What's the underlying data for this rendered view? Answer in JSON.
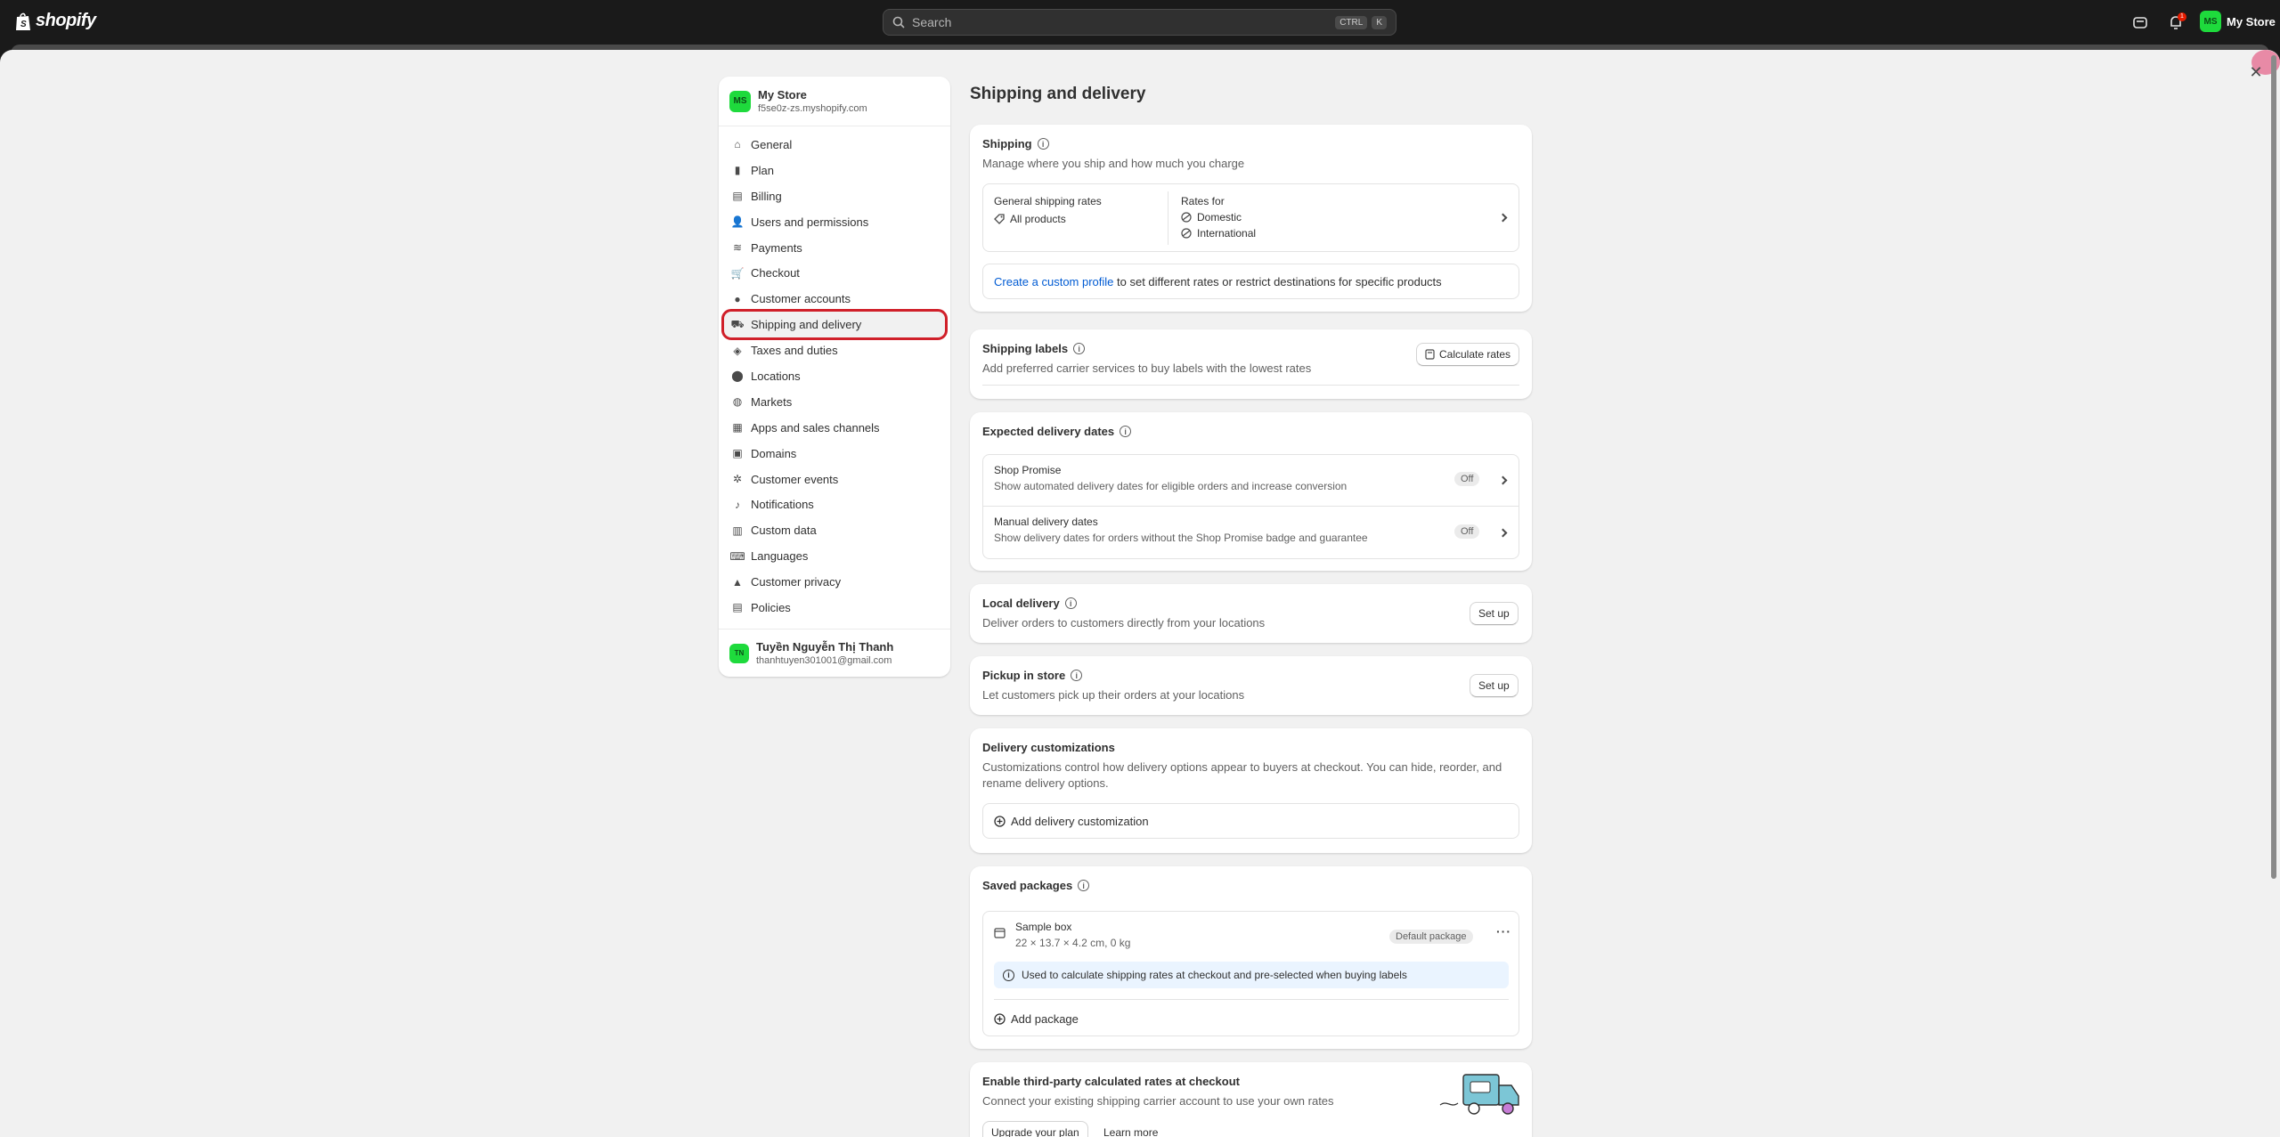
{
  "topbar": {
    "logo": "shopify",
    "search_placeholder": "Search",
    "kbd1": "CTRL",
    "kbd2": "K",
    "notif_count": "1",
    "store_initials": "MS",
    "store_name": "My Store"
  },
  "sidebar": {
    "store_initials": "MS",
    "store_name": "My Store",
    "store_domain": "f5se0z-zs.myshopify.com",
    "items": [
      {
        "label": "General",
        "icon": "store-icon"
      },
      {
        "label": "Plan",
        "icon": "plan-icon"
      },
      {
        "label": "Billing",
        "icon": "billing-icon"
      },
      {
        "label": "Users and permissions",
        "icon": "users-icon"
      },
      {
        "label": "Payments",
        "icon": "payments-icon"
      },
      {
        "label": "Checkout",
        "icon": "cart-icon"
      },
      {
        "label": "Customer accounts",
        "icon": "person-icon"
      },
      {
        "label": "Shipping and delivery",
        "icon": "truck-icon"
      },
      {
        "label": "Taxes and duties",
        "icon": "tax-icon"
      },
      {
        "label": "Locations",
        "icon": "location-icon"
      },
      {
        "label": "Markets",
        "icon": "globe-icon"
      },
      {
        "label": "Apps and sales channels",
        "icon": "apps-icon"
      },
      {
        "label": "Domains",
        "icon": "domain-icon"
      },
      {
        "label": "Customer events",
        "icon": "events-icon"
      },
      {
        "label": "Notifications",
        "icon": "bell-icon"
      },
      {
        "label": "Custom data",
        "icon": "data-icon"
      },
      {
        "label": "Languages",
        "icon": "language-icon"
      },
      {
        "label": "Customer privacy",
        "icon": "lock-icon"
      },
      {
        "label": "Policies",
        "icon": "policy-icon"
      }
    ],
    "active_index": 7,
    "user_initials": "TN",
    "user_name": "Tuyền Nguyễn Thị Thanh",
    "user_email": "thanhtuyen301001@gmail.com"
  },
  "main": {
    "title": "Shipping and delivery",
    "shipping": {
      "title": "Shipping",
      "subtitle": "Manage where you ship and how much you charge",
      "general_rates": "General shipping rates",
      "all_products": "All products",
      "rates_for": "Rates for",
      "domestic": "Domestic",
      "international": "International",
      "custom_link": "Create a custom profile",
      "custom_rest": " to set different rates or restrict destinations for specific products"
    },
    "labels": {
      "title": "Shipping labels",
      "subtitle": "Add preferred carrier services to buy labels with the lowest rates",
      "button": "Calculate rates"
    },
    "expected": {
      "title": "Expected delivery dates",
      "rows": [
        {
          "title": "Shop Promise",
          "desc": "Show automated delivery dates for eligible orders and increase conversion",
          "status": "Off"
        },
        {
          "title": "Manual delivery dates",
          "desc": "Show delivery dates for orders without the Shop Promise badge and guarantee",
          "status": "Off"
        }
      ]
    },
    "local": {
      "title": "Local delivery",
      "subtitle": "Deliver orders to customers directly from your locations",
      "button": "Set up"
    },
    "pickup": {
      "title": "Pickup in store",
      "subtitle": "Let customers pick up their orders at your locations",
      "button": "Set up"
    },
    "customizations": {
      "title": "Delivery customizations",
      "subtitle": "Customizations control how delivery options appear to buyers at checkout. You can hide, reorder, and rename delivery options.",
      "add": "Add delivery customization"
    },
    "packages": {
      "title": "Saved packages",
      "name": "Sample box",
      "dims": "22 × 13.7 × 4.2 cm, 0 kg",
      "badge": "Default package",
      "note": "Used to calculate shipping rates at checkout and pre-selected when buying labels",
      "add": "Add package"
    },
    "thirdparty": {
      "title": "Enable third-party calculated rates at checkout",
      "subtitle": "Connect your existing shipping carrier account to use your own rates",
      "upgrade": "Upgrade your plan",
      "learn": "Learn more"
    }
  },
  "colors": {
    "active_outline": "#d0202a",
    "link": "#005bd3",
    "avatar": "#1eda3c",
    "topbar": "#1a1a1a"
  }
}
